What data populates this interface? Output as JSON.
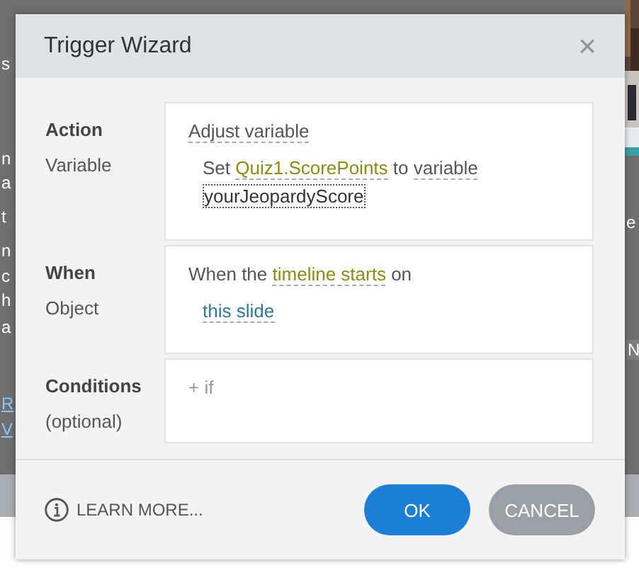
{
  "background": {
    "left_fragments": [
      {
        "kind": "text",
        "text": "s"
      },
      {
        "kind": "text",
        "text": "n"
      },
      {
        "kind": "text",
        "text": "a"
      },
      {
        "kind": "text",
        "text": "t"
      },
      {
        "kind": "text",
        "text": "n"
      },
      {
        "kind": "text",
        "text": "c"
      },
      {
        "kind": "text",
        "text": "h"
      },
      {
        "kind": "text",
        "text": "a"
      },
      {
        "kind": "link",
        "text": "R"
      },
      {
        "kind": "link",
        "text": "V"
      }
    ],
    "right_fragments": [
      {
        "kind": "text",
        "text": "e"
      },
      {
        "kind": "button",
        "text": "N"
      }
    ]
  },
  "dialog": {
    "title": "Trigger Wizard",
    "close": "×",
    "sections": [
      {
        "label": "Action",
        "sublabel": "Variable",
        "heading": [
          {
            "kind": "link",
            "text": "Adjust variable"
          }
        ],
        "lines": [
          [
            {
              "kind": "plain",
              "text": "Set "
            },
            {
              "kind": "param",
              "text": "Quiz1.ScorePoints"
            },
            {
              "kind": "plain",
              "text": " to "
            },
            {
              "kind": "link",
              "text": "variable"
            }
          ],
          [
            {
              "kind": "value",
              "text": "yourJeopardyScore"
            }
          ]
        ]
      },
      {
        "label": "When",
        "sublabel": "Object",
        "heading": [
          {
            "kind": "plain",
            "text": "When the "
          },
          {
            "kind": "param",
            "text": "timeline starts"
          },
          {
            "kind": "plain",
            "text": " on"
          }
        ],
        "lines": [
          [
            {
              "kind": "object",
              "text": "this slide"
            }
          ]
        ]
      },
      {
        "label": "Conditions",
        "sublabel": "(optional)",
        "heading": [
          {
            "kind": "add",
            "text": "+ if"
          }
        ]
      }
    ],
    "learn_more": "LEARN MORE...",
    "buttons": [
      {
        "kind": "primary",
        "label": "OK"
      },
      {
        "kind": "secondary",
        "label": "CANCEL"
      }
    ]
  }
}
